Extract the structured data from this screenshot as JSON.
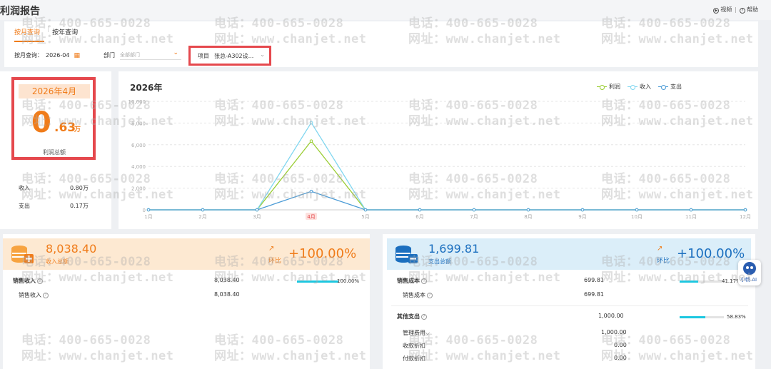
{
  "header": {
    "title": "利润报告",
    "links": [
      {
        "label": "视频",
        "icon": "play-circle-icon"
      },
      {
        "label": "帮助",
        "icon": "question-circle-icon"
      }
    ]
  },
  "filters": {
    "tabs": [
      {
        "label": "按月查询",
        "active": true
      },
      {
        "label": "按年查询",
        "active": false
      }
    ],
    "month_label": "按月查询：",
    "month_value": "2026-04",
    "dept_label": "部门",
    "dept_placeholder": "全部部门",
    "project_label": "项目",
    "project_value": "张总-A302设..."
  },
  "summary": {
    "period": "2026年4月",
    "profit_int": "0",
    "profit_dec": ".63",
    "profit_unit": "万",
    "profit_label": "利润总额",
    "income_label": "收入",
    "income_value": "0.80万",
    "expense_label": "支出",
    "expense_value": "0.17万"
  },
  "chart_data": {
    "type": "line",
    "title": "2026年",
    "x": [
      "1月",
      "2月",
      "3月",
      "4月",
      "5月",
      "6月",
      "7月",
      "8月",
      "9月",
      "10月",
      "11月",
      "12月"
    ],
    "highlight_x": "4月",
    "ylim": [
      0,
      10000
    ],
    "yticks": [
      "0",
      "2,000",
      "4,000",
      "6,000",
      "8,000",
      "10,000"
    ],
    "legend_position": "top-right",
    "series": [
      {
        "name": "利润",
        "color": "#9acd32",
        "values": [
          0,
          0,
          0,
          6338.59,
          0,
          0,
          0,
          0,
          0,
          0,
          0,
          0
        ]
      },
      {
        "name": "收入",
        "color": "#7fd6f0",
        "values": [
          0,
          0,
          0,
          8038.4,
          0,
          0,
          0,
          0,
          0,
          0,
          0,
          0
        ]
      },
      {
        "name": "支出",
        "color": "#4a9bd6",
        "values": [
          0,
          0,
          0,
          1699.81,
          0,
          0,
          0,
          0,
          0,
          0,
          0,
          0
        ]
      }
    ]
  },
  "income_panel": {
    "total": "8,038.40",
    "total_label": "收入总额",
    "huanbi_label": "环比",
    "huanbi_value": "+100.00%",
    "rows": [
      {
        "label": "销售收入",
        "value": "8,038.40",
        "bold": true,
        "pct": "100.00%",
        "fill": 1.0
      },
      {
        "label": "销售收入",
        "value": "8,038.40",
        "bold": false
      }
    ]
  },
  "expense_panel": {
    "total": "1,699.81",
    "total_label": "支出总额",
    "huanbi_label": "环比",
    "huanbi_value": "+100.00%",
    "rows": [
      {
        "label": "销售成本",
        "value": "699.81",
        "bold": true,
        "pct": "41.17%",
        "fill": 0.4117
      },
      {
        "label": "销售成本",
        "value": "699.81",
        "bold": false
      },
      {
        "label": "其他支出",
        "value": "1,000.00",
        "bold": true,
        "pct": "58.83%",
        "fill": 0.5883
      },
      {
        "label": "管理费用",
        "value": "1,000.00",
        "bold": false
      },
      {
        "label": "收款折扣",
        "value": "0.00",
        "bold": false
      },
      {
        "label": "付款折扣",
        "value": "0.00",
        "bold": false
      }
    ]
  },
  "watermark": {
    "phone": "电话：400-665-0028",
    "site": "网址：www.chanjet.net"
  },
  "ai_assistant": {
    "label": "小畅 AI"
  }
}
